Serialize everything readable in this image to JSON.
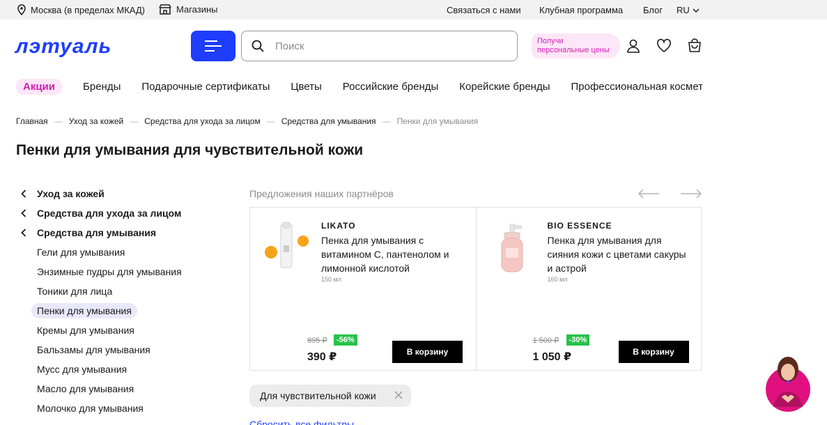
{
  "topbar": {
    "location": "Москва (в пределах МКАД)",
    "shops": "Магазины",
    "contact": "Связаться с нами",
    "club": "Клубная программа",
    "blog": "Блог",
    "lang": "RU"
  },
  "header": {
    "logo": "лэтуаль",
    "search_placeholder": "Поиск",
    "promo_line1": "Получи",
    "promo_line2": "персональные цены"
  },
  "nav": {
    "promo": "Акции",
    "items": [
      "Бренды",
      "Подарочные сертификаты",
      "Цветы",
      "Российские бренды",
      "Корейские бренды",
      "Профессиональная косметика"
    ]
  },
  "breadcrumbs": [
    "Главная",
    "Уход за кожей",
    "Средства для ухода за лицом",
    "Средства для умывания",
    "Пенки для умывания"
  ],
  "page_title": "Пенки для умывания для чувствительной кожи",
  "sidebar": {
    "parents": [
      "Уход за кожей",
      "Средства для ухода за лицом",
      "Средства для умывания"
    ],
    "children": [
      "Гели для умывания",
      "Энзимные пудры для умывания",
      "Тоники для лица",
      "Пенки для умывания",
      "Кремы для умывания",
      "Бальзамы для умывания",
      "Мусс для умывания",
      "Масло для умывания",
      "Молочко для умывания"
    ]
  },
  "partners": {
    "title": "Предложения наших партнёров",
    "cards": [
      {
        "brand": "LIKATO",
        "name": "Пенка для умывания с витамином С, пантенолом и лимонной кислотой",
        "volume": "150 мл",
        "old_price": "895 ₽",
        "discount": "-56%",
        "price": "390 ₽",
        "cart": "В корзину"
      },
      {
        "brand": "BIO ESSENCE",
        "name": "Пенка для умывания для сияния кожи с цветами сакуры и астрой",
        "volume": "160 мл",
        "old_price": "1 500 ₽",
        "discount": "-30%",
        "price": "1 050 ₽",
        "cart": "В корзину"
      }
    ]
  },
  "filter": {
    "chip": "Для чувствительной кожи",
    "reset": "Сбросить все фильтры"
  },
  "colors": {
    "brand_blue": "#1e3dff",
    "promo_pink": "#d11fb3",
    "discount_green": "#27c24a"
  }
}
